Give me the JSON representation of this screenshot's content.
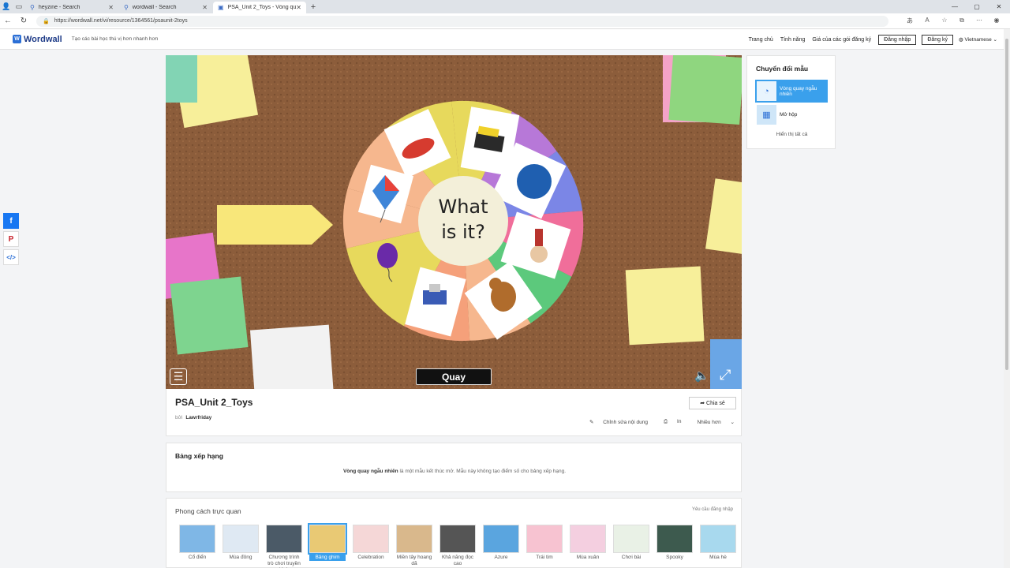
{
  "browser": {
    "tabs": [
      {
        "label": "heyzine - Search",
        "icon": "search-icon"
      },
      {
        "label": "wordwall - Search",
        "icon": "search-icon"
      },
      {
        "label": "PSA_Unit 2_Toys - Vòng qua...",
        "icon": "wordwall-icon"
      }
    ],
    "url": "https://wordwall.net/vi/resource/1364561/psaunit-2toys"
  },
  "site": {
    "logo": "Wordwall",
    "tagline": "Tạo các bài học thú vị hơn nhanh hơn",
    "nav": {
      "home": "Trang chủ",
      "features": "Tính năng",
      "pricing": "Giá của các gói đăng ký",
      "login": "Đăng nhập",
      "signup": "Đăng ký",
      "language": "Vietnamese"
    }
  },
  "game": {
    "center_text_line1": "What",
    "center_text_line2": "is it?",
    "spin_label": "Quay",
    "colors": {
      "yellow": "#e7d95c",
      "purple": "#b778d8",
      "blue": "#7b86e6",
      "pink": "#f06e9a",
      "green": "#5cc97c",
      "peach": "#f6b78e",
      "salmon": "#f5a07a",
      "center": "#f3efd9"
    }
  },
  "side_panel": {
    "title": "Chuyển đổi mẫu",
    "templates": [
      {
        "label": "Vòng quay ngẫu nhiên",
        "icon": "wheel-icon"
      },
      {
        "label": "Mở hộp",
        "icon": "boxes-icon"
      }
    ],
    "show_all": "Hiển thị tất cả"
  },
  "activity": {
    "title": "PSA_Unit 2_Toys",
    "by": "bởi",
    "author": "Lawrfriday",
    "share": "Chia sẻ",
    "edit": "Chỉnh sửa nội dung",
    "print": "In",
    "more": "Nhiều hơn"
  },
  "leaderboard": {
    "title": "Bảng xếp hạng",
    "bold_text": "Vòng quay ngẫu nhiên",
    "text": " là một mẫu kết thúc mở. Mẫu này không tạo điểm số cho bảng xếp hạng."
  },
  "themes": {
    "title": "Phong cách trực quan",
    "login_required": "Yêu cầu đăng nhập",
    "items": [
      {
        "label": "Cổ điển",
        "color": "#7fb7e6"
      },
      {
        "label": "Mùa đông",
        "color": "#dfe9f3"
      },
      {
        "label": "Chương trình trò chơi truyền hình",
        "color": "#4b5a67"
      },
      {
        "label": "Bảng ghim",
        "color": "#e9c974"
      },
      {
        "label": "Celebration",
        "color": "#f5d7d7"
      },
      {
        "label": "Miền tây hoang dã",
        "color": "#d9b88c"
      },
      {
        "label": "Khả năng đọc cao",
        "color": "#555555"
      },
      {
        "label": "Azure",
        "color": "#5aa5df"
      },
      {
        "label": "Trái tim",
        "color": "#f7c3d1"
      },
      {
        "label": "Mùa xuân",
        "color": "#f4cfe0"
      },
      {
        "label": "Chơi bài",
        "color": "#e9f1e6"
      },
      {
        "label": "Spooky",
        "color": "#3d5a4e"
      },
      {
        "label": "Mùa hè",
        "color": "#a8d9ee"
      }
    ]
  }
}
